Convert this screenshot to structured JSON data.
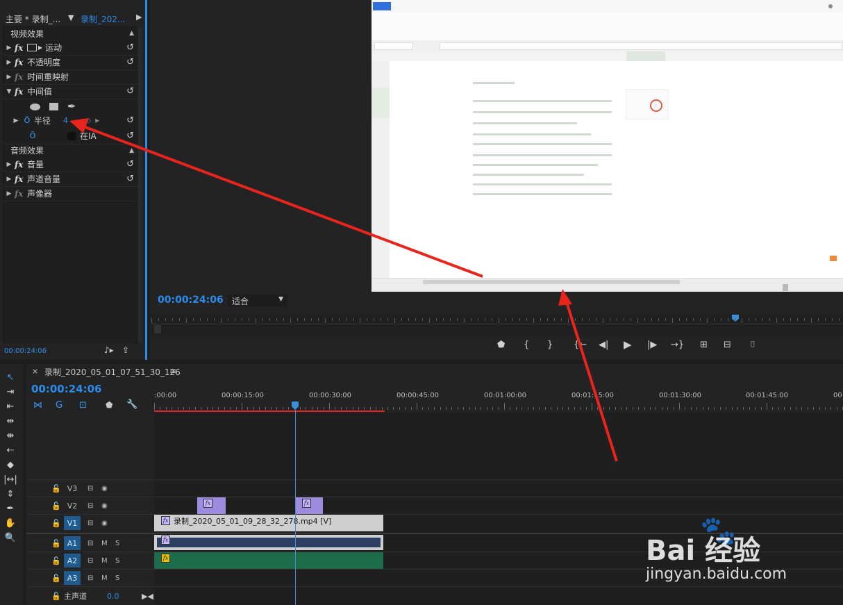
{
  "effect_controls": {
    "tab_main": "主要 * 录制_...",
    "tab_active": "录制_202...",
    "video_section": "视频效果",
    "items": [
      {
        "label": "运动",
        "has_reset": true
      },
      {
        "label": "不透明度",
        "has_reset": true
      },
      {
        "label": "时间重映射",
        "has_reset": false
      },
      {
        "label": "中间值",
        "has_reset": true
      }
    ],
    "radius_label": "半径",
    "radius_value": "4",
    "blend_label": "在IA",
    "audio_section": "音频效果",
    "audio_items": [
      {
        "label": "音量",
        "has_reset": true
      },
      {
        "label": "声道音量",
        "has_reset": true
      },
      {
        "label": "声像器",
        "has_reset": false
      }
    ],
    "timecode": "00:00:24:06"
  },
  "program_monitor": {
    "timecode": "00:00:24:06",
    "fit_label": "适合"
  },
  "timeline": {
    "sequence_name": "录制_2020_05_01_07_51_30_126",
    "timecode": "00:00:24:06",
    "ruler_labels": [
      ":00:00",
      "00:00:15:00",
      "00:00:30:00",
      "00:00:45:00",
      "00:01:00:00",
      "00:01:15:00",
      "00:01:30:00",
      "00:01:45:00",
      "00"
    ],
    "tracks": {
      "v3": "V3",
      "v2": "V2",
      "v1": "V1",
      "a1": "A1",
      "a2": "A2",
      "a3": "A3",
      "master": "主声道",
      "master_value": "0.0",
      "m": "M",
      "s": "S"
    },
    "clip_v1_name": "录制_2020_05_01_09_28_32_278.mp4 [V]"
  },
  "watermark": {
    "brand": "Bai 经验",
    "url": "jingyan.baidu.com"
  },
  "colors": {
    "accent_blue": "#2d8ceb",
    "playhead": "#3a8fd6",
    "audio_green": "#1c6b4a",
    "clip_purple": "#9d8be0",
    "annotation_red": "#e8241c"
  }
}
